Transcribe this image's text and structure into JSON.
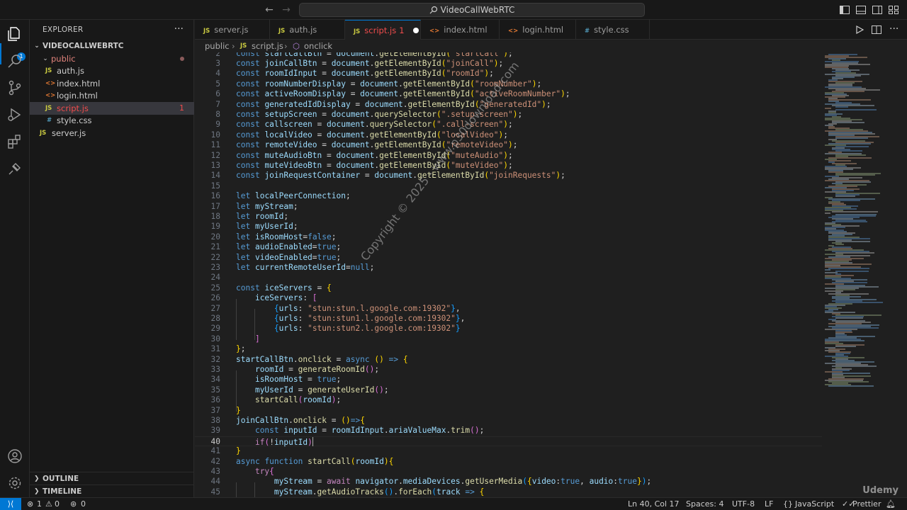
{
  "window": {
    "search_text": "VideoCallWebRTC"
  },
  "activity": {
    "explorer_badge": "1"
  },
  "sidebar": {
    "header": "EXPLORER",
    "project": "VIDEOCALLWEBRTC",
    "folder": "public",
    "files": [
      {
        "icon": "JS",
        "name": "auth.js"
      },
      {
        "icon": "<>",
        "name": "index.html"
      },
      {
        "icon": "<>",
        "name": "login.html"
      },
      {
        "icon": "JS",
        "name": "script.js",
        "problems": "1"
      },
      {
        "icon": "#",
        "name": "style.css"
      }
    ],
    "root_file": {
      "icon": "JS",
      "name": "server.js"
    },
    "outline": "OUTLINE",
    "timeline": "TIMELINE"
  },
  "tabs": [
    {
      "icon": "JS",
      "label": "server.js"
    },
    {
      "icon": "JS",
      "label": "auth.js"
    },
    {
      "icon": "JS",
      "label": "script.js",
      "problems": "1"
    },
    {
      "icon": "<>",
      "label": "index.html"
    },
    {
      "icon": "<>",
      "label": "login.html"
    },
    {
      "icon": "#",
      "label": "style.css"
    }
  ],
  "breadcrumb": {
    "folder": "public",
    "file_icon": "JS",
    "file": "script.js",
    "symbol": "onclick"
  },
  "editor": {
    "lines": [
      {
        "n": "2",
        "code": "const startCallBtn = document.getElementById(\"startCall\");"
      },
      {
        "n": "3",
        "code": "const joinCallBtn = document.getElementById(\"joinCall\");"
      },
      {
        "n": "4",
        "code": "const roomIdInput = document.getElementById(\"roomId\");"
      },
      {
        "n": "5",
        "code": "const roomNumberDisplay = document.getElementById(\"roomNumber\");"
      },
      {
        "n": "6",
        "code": "const activeRoomDisplay = document.getElementById(\"activeRoomNumber\");"
      },
      {
        "n": "7",
        "code": "const generatedIdDisplay = document.getElementById(\"generatedId\");"
      },
      {
        "n": "8",
        "code": "const setupScreen = document.querySelector(\".setup-screen\");"
      },
      {
        "n": "9",
        "code": "const callscreen = document.querySelector(\".call-screen\");"
      },
      {
        "n": "10",
        "code": "const localVideo = document.getElementById(\"localVideo\");"
      },
      {
        "n": "11",
        "code": "const remoteVideo = document.getElementById(\"remoteVideo\");"
      },
      {
        "n": "12",
        "code": "const muteAudioBtn = document.getElementById(\"muteAudio\");"
      },
      {
        "n": "13",
        "code": "const muteVideoBtn = document.getElementById(\"muteVideo\");"
      },
      {
        "n": "14",
        "code": "const joinRequestContainer = document.getElementById(\"joinRequests\");"
      },
      {
        "n": "15",
        "code": ""
      },
      {
        "n": "16",
        "code": "let localPeerConnection;"
      },
      {
        "n": "17",
        "code": "let myStream;"
      },
      {
        "n": "18",
        "code": "let roomId;"
      },
      {
        "n": "19",
        "code": "let myUserId;"
      },
      {
        "n": "20",
        "code": "let isRoomHost=false;"
      },
      {
        "n": "21",
        "code": "let audioEnabled=true;"
      },
      {
        "n": "22",
        "code": "let videoEnabled=true;"
      },
      {
        "n": "23",
        "code": "let currentRemoteUserId=null;"
      },
      {
        "n": "24",
        "code": ""
      },
      {
        "n": "25",
        "code": "const iceServers = {"
      },
      {
        "n": "26",
        "code": "    iceServers: ["
      },
      {
        "n": "27",
        "code": "        {urls: \"stun:stun.l.google.com:19302\"},"
      },
      {
        "n": "28",
        "code": "        {urls: \"stun:stun1.l.google.com:19302\"},"
      },
      {
        "n": "29",
        "code": "        {urls: \"stun:stun2.l.google.com:19302\"}"
      },
      {
        "n": "30",
        "code": "    ]"
      },
      {
        "n": "31",
        "code": "};"
      },
      {
        "n": "32",
        "code": "startCallBtn.onclick = async () => {"
      },
      {
        "n": "33",
        "code": "    roomId = generateRoomId();"
      },
      {
        "n": "34",
        "code": "    isRoomHost = true;"
      },
      {
        "n": "35",
        "code": "    myUserId = generateUserId();"
      },
      {
        "n": "36",
        "code": "    startCall(roomId);"
      },
      {
        "n": "37",
        "code": "}"
      },
      {
        "n": "38",
        "code": "joinCallBtn.onclick = ()=>{"
      },
      {
        "n": "39",
        "code": "    const inputId = roomIdInput.ariaValueMax.trim();"
      },
      {
        "n": "40",
        "code": "    if(!inputId)"
      },
      {
        "n": "41",
        "code": "}"
      },
      {
        "n": "42",
        "code": "async function startCall(roomId){"
      },
      {
        "n": "43",
        "code": "    try{"
      },
      {
        "n": "44",
        "code": "        myStream = await navigator.mediaDevices.getUserMedia({video:true, audio:true});"
      },
      {
        "n": "45",
        "code": "        myStream.getAudioTracks().forEach(track => {"
      }
    ]
  },
  "watermark": "Copyright © 2025 - www.p30download.com",
  "udemy": "Udemy",
  "status": {
    "errors": "1",
    "warnings": "0",
    "ports": "0",
    "position": "Ln 40, Col 17",
    "spaces": "Spaces: 4",
    "encoding": "UTF-8",
    "eol": "LF",
    "language": "JavaScript",
    "formatter": "Prettier"
  }
}
